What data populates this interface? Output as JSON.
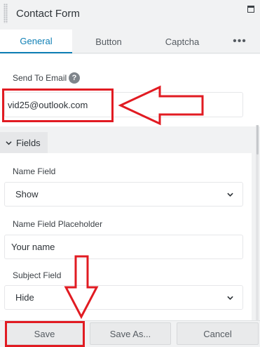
{
  "panel": {
    "title": "Contact Form"
  },
  "tabs": [
    {
      "label": "General",
      "active": true
    },
    {
      "label": "Button"
    },
    {
      "label": "Captcha"
    },
    {
      "label": "•••"
    }
  ],
  "general": {
    "send_to_email_label": "Send To Email",
    "help_glyph": "?",
    "email_value": "vid25@outlook.com"
  },
  "fields": {
    "section_label": "Fields",
    "name_field_label": "Name Field",
    "name_field_value": "Show",
    "name_placeholder_label": "Name Field Placeholder",
    "name_placeholder_value": "Your name",
    "subject_field_label": "Subject Field",
    "subject_field_value": "Hide"
  },
  "footer": {
    "save_label": "Save",
    "save_as_label": "Save As...",
    "cancel_label": "Cancel"
  },
  "colors": {
    "accent": "#0e7fb5",
    "annotation": "#e11b22"
  }
}
